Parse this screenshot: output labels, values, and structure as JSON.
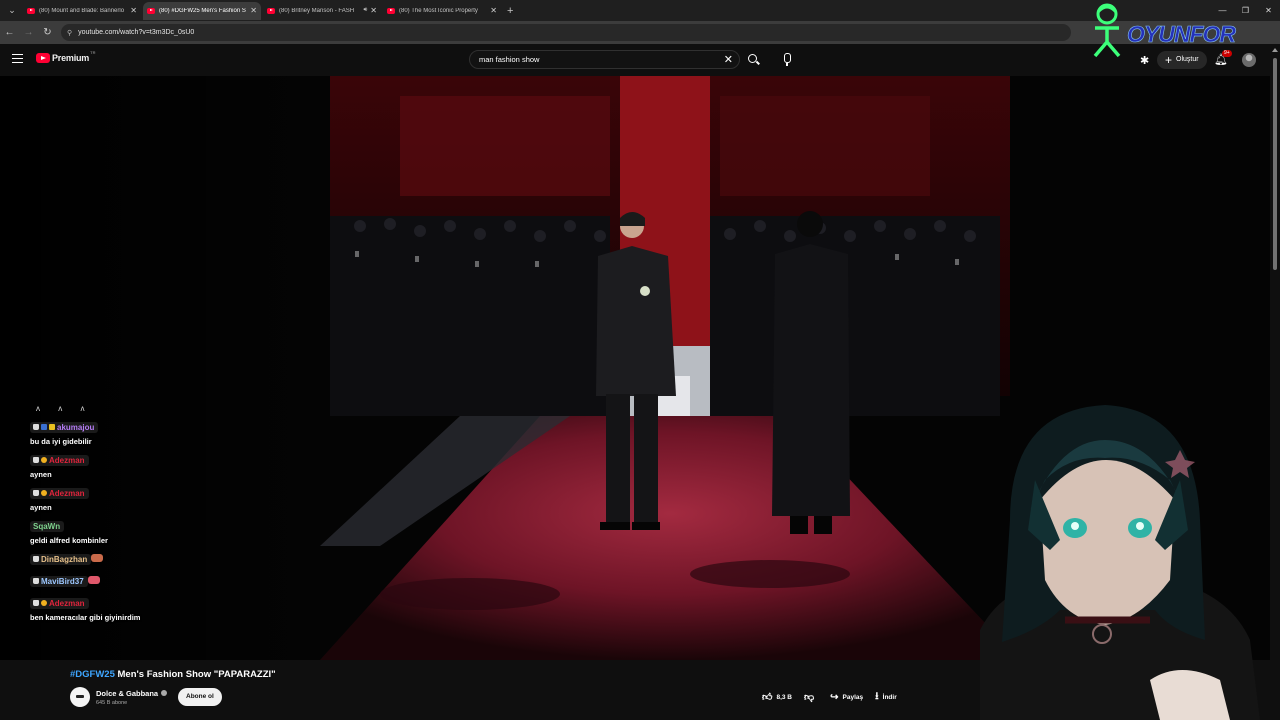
{
  "browser": {
    "tabs": [
      {
        "title": "(80) Mount and Blade: Bannerlo",
        "active": false,
        "audio": false
      },
      {
        "title": "(80) #DGFW25 Men's Fashion S",
        "active": true,
        "audio": false
      },
      {
        "title": "(80) Britney Manson - FASH",
        "active": false,
        "audio": true
      },
      {
        "title": "(80) The Most Iconic Property",
        "active": false,
        "audio": false
      }
    ],
    "url": "youtube.com/watch?v=t3m3Dc_0sU0"
  },
  "youtube": {
    "brand": "Premium",
    "brand_region": "TR",
    "search_value": "man fashion show",
    "create_label": "Oluştur",
    "notifications_badge": "9+"
  },
  "stream_logo": "OYUNFOR",
  "chat": {
    "top_dots": "ʌ ʌ ʌ",
    "messages": [
      {
        "user": "akumajou",
        "color": "#b57cf5",
        "badges": [
          "tv",
          "blue",
          "yel"
        ],
        "text": "bu da iyi gidebilir"
      },
      {
        "user": "Adezman",
        "color": "#e0243c",
        "badges": [
          "tv",
          "gold"
        ],
        "text": "aynen"
      },
      {
        "user": "Adezman",
        "color": "#e0243c",
        "badges": [
          "tv",
          "gold"
        ],
        "text": "aynen"
      },
      {
        "user": "SqaWn",
        "color": "#7fd38e",
        "badges": [],
        "text": "geldi alfred kombinler"
      },
      {
        "user": "DinBagzhan",
        "color": "#e7c08a",
        "badges": [
          "tv"
        ],
        "text": "",
        "emote": "#c96a4a"
      },
      {
        "user": "MaviBird37",
        "color": "#9dc8ff",
        "badges": [
          "tv"
        ],
        "text": "",
        "emote": "#e0586b"
      },
      {
        "user": "Adezman",
        "color": "#e0243c",
        "badges": [
          "tv",
          "gold"
        ],
        "text": "ben kameracılar gibi giyinirdim"
      }
    ]
  },
  "video": {
    "title_hashtag": "#DGFW25",
    "title_rest": " Men's Fashion Show \"PAPARAZZI\"",
    "channel": "Dolce & Gabbana",
    "subscribers": "645 B abone",
    "subscribe_label": "Abone ol",
    "likes": "8,3 B",
    "share_label": "Paylaş",
    "download_label": "İndir"
  },
  "colors": {
    "accent_red": "#ff0033",
    "hashtag_blue": "#3ea6ff",
    "runway_red": "#8b1a2b"
  },
  "icons": {
    "menu": "hamburger-icon",
    "search": "search-icon",
    "mic": "mic-icon",
    "create": "plus-icon",
    "bell": "bell-icon",
    "like": "thumbs-up-icon",
    "dislike": "thumbs-down-icon",
    "share": "share-icon",
    "download": "download-icon"
  }
}
